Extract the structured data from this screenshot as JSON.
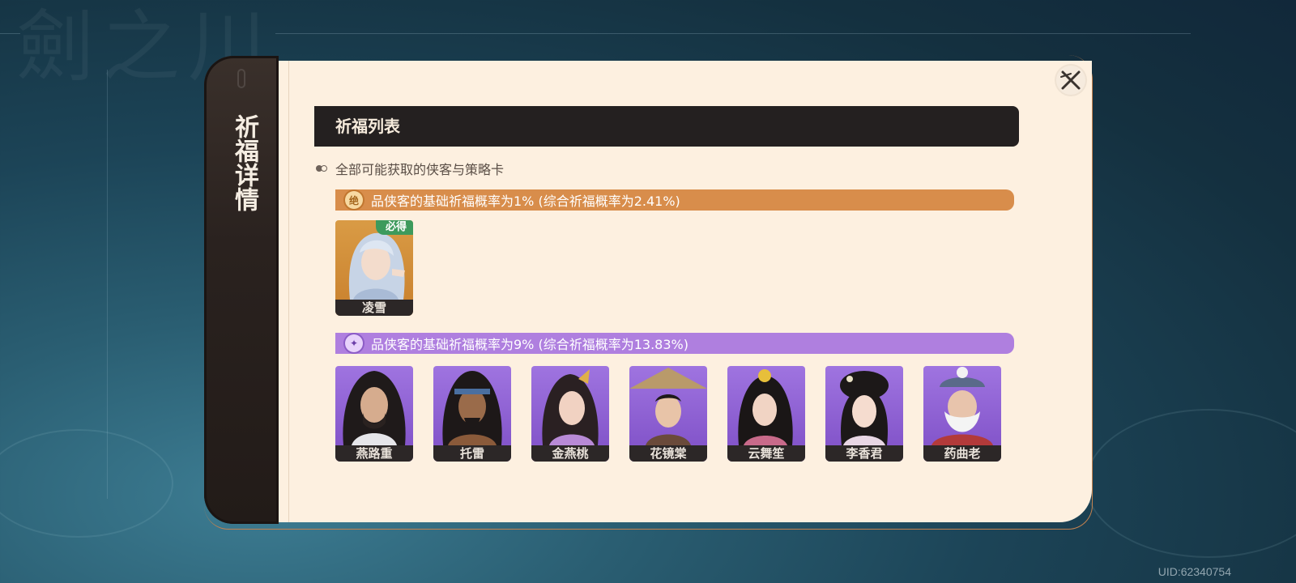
{
  "background": {
    "watermark": "劍之川"
  },
  "dialog": {
    "sidebar_title": "祈福详情",
    "close_icon": "close-x-icon",
    "section_title": "祈福列表",
    "subtitle": "全部可能获取的侠客与策略卡",
    "tiers": [
      {
        "label": "品侠客的基础祈福概率为1% (综合祈福概率为2.41%)",
        "icon_glyph": "绝",
        "color": "#d88d4b",
        "cards": [
          {
            "name": "凌雪",
            "badge": "必得"
          }
        ]
      },
      {
        "label": "品侠客的基础祈福概率为9% (综合祈福概率为13.83%)",
        "icon_glyph": "✦",
        "color": "#af7fdf",
        "cards": [
          {
            "name": "燕路重"
          },
          {
            "name": "托雷"
          },
          {
            "name": "金燕桃"
          },
          {
            "name": "花镜棠"
          },
          {
            "name": "云舞笙"
          },
          {
            "name": "李香君"
          },
          {
            "name": "药曲老"
          }
        ]
      }
    ]
  },
  "uid": "UID:62340754"
}
